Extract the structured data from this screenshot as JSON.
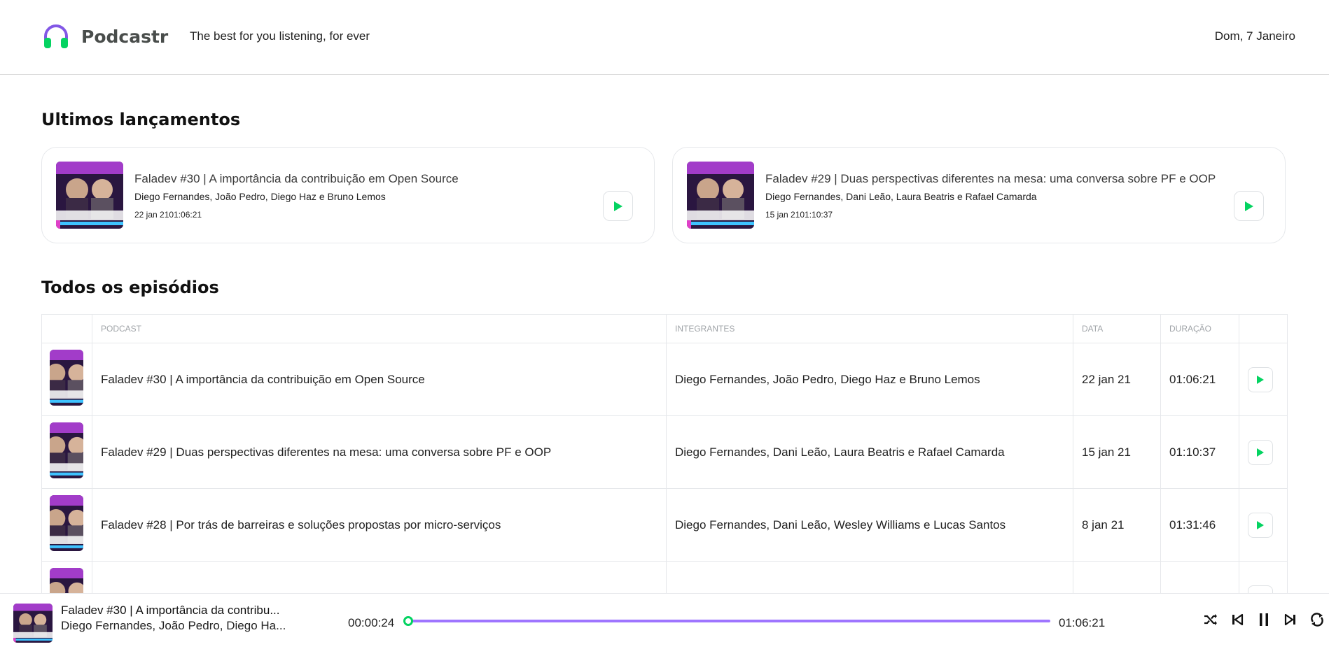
{
  "header": {
    "app_name": "Podcastr",
    "tagline": "The best for you listening, for ever",
    "date": "Dom, 7 Janeiro",
    "logo_icon": "headphones-icon"
  },
  "latest": {
    "title": "Ultimos lançamentos",
    "cards": [
      {
        "title": "Faladev #30 | A importância da contribuição em Open Source",
        "members": "Diego Fernandes, João Pedro, Diego Haz e Bruno Lemos",
        "meta": "22 jan 2101:06:21"
      },
      {
        "title": "Faladev #29 | Duas perspectivas diferentes na mesa: uma conversa sobre PF e OOP",
        "members": "Diego Fernandes, Dani Leão, Laura Beatris e Rafael Camarda",
        "meta": "15 jan 2101:10:37"
      }
    ]
  },
  "all": {
    "title": "Todos os episódios",
    "columns": [
      "",
      "Podcast",
      "Integrantes",
      "Data",
      "Duração",
      ""
    ],
    "rows": [
      {
        "title": "Faladev #30 | A importância da contribuição em Open Source",
        "members": "Diego Fernandes, João Pedro, Diego Haz e Bruno Lemos",
        "date": "22 jan 21",
        "duration": "01:06:21"
      },
      {
        "title": "Faladev #29 | Duas perspectivas diferentes na mesa: uma conversa sobre PF e OOP",
        "members": "Diego Fernandes, Dani Leão, Laura Beatris e Rafael Camarda",
        "date": "15 jan 21",
        "duration": "01:10:37"
      },
      {
        "title": "Faladev #28 | Por trás de barreiras e soluções propostas por micro-serviços",
        "members": "Diego Fernandes, Dani Leão, Wesley Williams e Lucas Santos",
        "date": "8 jan 21",
        "duration": "01:31:46"
      },
      {
        "title": "",
        "members": "",
        "date": "",
        "duration": ""
      }
    ]
  },
  "player": {
    "title": "Faladev #30 | A importância da contribu...",
    "members": "Diego Fernandes, João Pedro, Diego Ha...",
    "current_time": "00:00:24",
    "total_time": "01:06:21",
    "progress": 0.006,
    "controls": [
      "shuffle-icon",
      "previous-icon",
      "pause-icon",
      "next-icon",
      "repeat-icon"
    ]
  },
  "colors": {
    "accent_green": "#04d361",
    "progress_purple": "#9f75ff",
    "border": "#e6e8eb"
  }
}
